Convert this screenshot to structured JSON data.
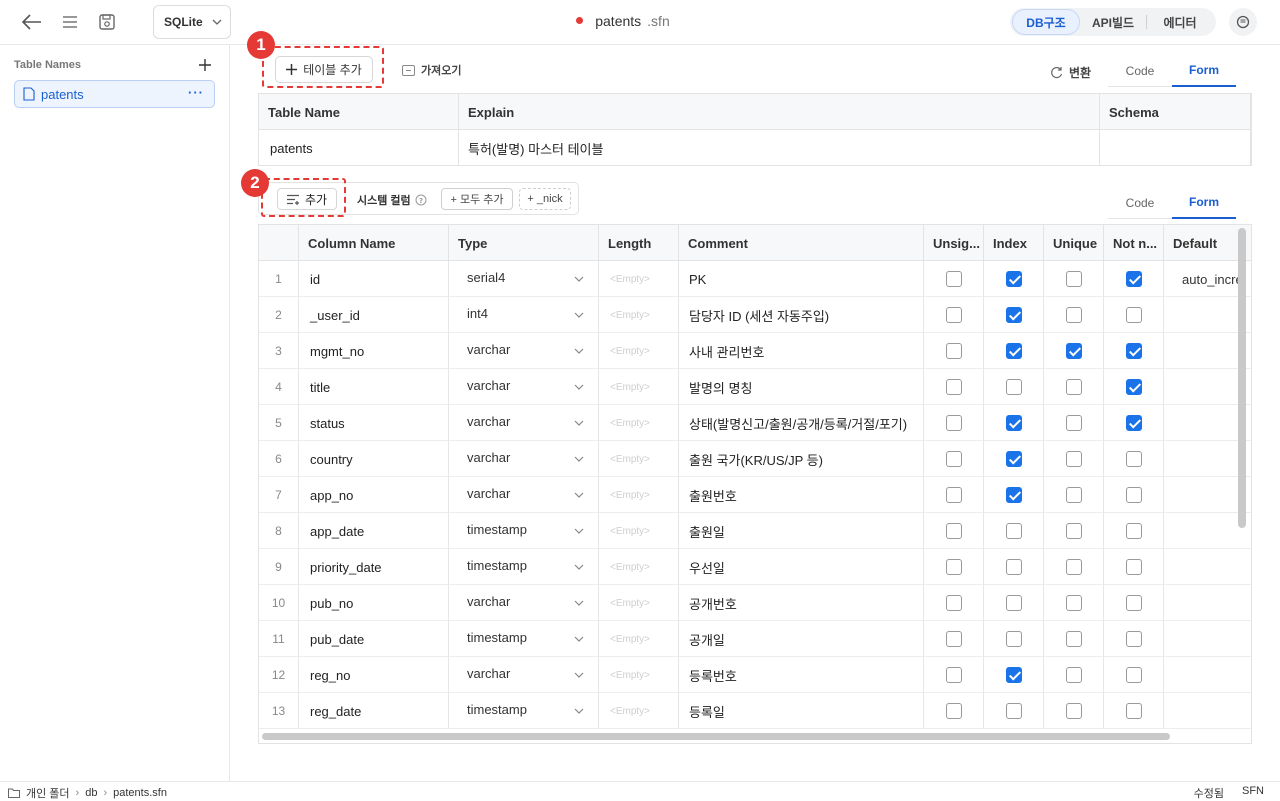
{
  "topbar": {
    "db_engine": "SQLite",
    "file_name": "patents",
    "file_ext": ".sfn",
    "views": [
      "DB구조",
      "API빌드",
      "에디터"
    ],
    "active_view": "DB구조"
  },
  "sidebar": {
    "heading": "Table Names",
    "tables": [
      {
        "label": "patents",
        "more": "···"
      }
    ]
  },
  "toolbar": {
    "add_table": "테이블 추가",
    "import": "가져오기",
    "convert": "변환",
    "tabs": [
      "Code",
      "Form"
    ],
    "active_tab": "Form"
  },
  "annotations": [
    "1",
    "2"
  ],
  "table_grid": {
    "headers": [
      "Table Name",
      "Explain",
      "Schema"
    ],
    "row": {
      "name": "patents",
      "explain": "특허(발명) 마스터 테이블",
      "schema": ""
    }
  },
  "column_toolbar": {
    "add": "추가",
    "system_columns": "시스템 컬럼",
    "add_all": "+ 모두 추가",
    "nick": "+ _nick",
    "tabs": [
      "Code",
      "Form"
    ],
    "active_tab": "Form"
  },
  "columns_grid": {
    "headers": [
      "Column Name",
      "Type",
      "Length",
      "Comment",
      "Unsig...",
      "Index",
      "Unique",
      "Not n...",
      "Default"
    ],
    "empty_placeholder": "<Empty>",
    "rows": [
      {
        "num": "1",
        "name": "id",
        "type": "serial4",
        "comment": "PK",
        "unsigned": false,
        "index": true,
        "unique": false,
        "not_null": true,
        "default": "auto_incre"
      },
      {
        "num": "2",
        "name": "_user_id",
        "type": "int4",
        "comment": "담당자 ID (세션 자동주입)",
        "unsigned": false,
        "index": true,
        "unique": false,
        "not_null": false,
        "default": ""
      },
      {
        "num": "3",
        "name": "mgmt_no",
        "type": "varchar",
        "comment": "사내 관리번호",
        "unsigned": false,
        "index": true,
        "unique": true,
        "not_null": true,
        "default": ""
      },
      {
        "num": "4",
        "name": "title",
        "type": "varchar",
        "comment": "발명의 명칭",
        "unsigned": false,
        "index": false,
        "unique": false,
        "not_null": true,
        "default": ""
      },
      {
        "num": "5",
        "name": "status",
        "type": "varchar",
        "comment": "상태(발명신고/출원/공개/등록/거절/포기)",
        "unsigned": false,
        "index": true,
        "unique": false,
        "not_null": true,
        "default": ""
      },
      {
        "num": "6",
        "name": "country",
        "type": "varchar",
        "comment": "출원 국가(KR/US/JP 등)",
        "unsigned": false,
        "index": true,
        "unique": false,
        "not_null": false,
        "default": ""
      },
      {
        "num": "7",
        "name": "app_no",
        "type": "varchar",
        "comment": "출원번호",
        "unsigned": false,
        "index": true,
        "unique": false,
        "not_null": false,
        "default": ""
      },
      {
        "num": "8",
        "name": "app_date",
        "type": "timestamp",
        "comment": "출원일",
        "unsigned": false,
        "index": false,
        "unique": false,
        "not_null": false,
        "default": ""
      },
      {
        "num": "9",
        "name": "priority_date",
        "type": "timestamp",
        "comment": "우선일",
        "unsigned": false,
        "index": false,
        "unique": false,
        "not_null": false,
        "default": ""
      },
      {
        "num": "10",
        "name": "pub_no",
        "type": "varchar",
        "comment": "공개번호",
        "unsigned": false,
        "index": false,
        "unique": false,
        "not_null": false,
        "default": ""
      },
      {
        "num": "11",
        "name": "pub_date",
        "type": "timestamp",
        "comment": "공개일",
        "unsigned": false,
        "index": false,
        "unique": false,
        "not_null": false,
        "default": ""
      },
      {
        "num": "12",
        "name": "reg_no",
        "type": "varchar",
        "comment": "등록번호",
        "unsigned": false,
        "index": true,
        "unique": false,
        "not_null": false,
        "default": ""
      },
      {
        "num": "13",
        "name": "reg_date",
        "type": "timestamp",
        "comment": "등록일",
        "unsigned": false,
        "index": false,
        "unique": false,
        "not_null": false,
        "default": ""
      }
    ]
  },
  "statusbar": {
    "breadcrumb": [
      "개인 폴더",
      "db",
      "patents.sfn"
    ],
    "state": "수정됨",
    "format": "SFN"
  },
  "icons": {
    "back": "arrow-left-icon",
    "menu": "hamburger-icon",
    "save": "save-icon",
    "chat": "chat-icon",
    "folder": "folder-icon",
    "file": "file-icon"
  },
  "colors": {
    "accent": "#1a5fd1",
    "annotation": "#e53935",
    "checkbox_on": "#1a73e8"
  }
}
